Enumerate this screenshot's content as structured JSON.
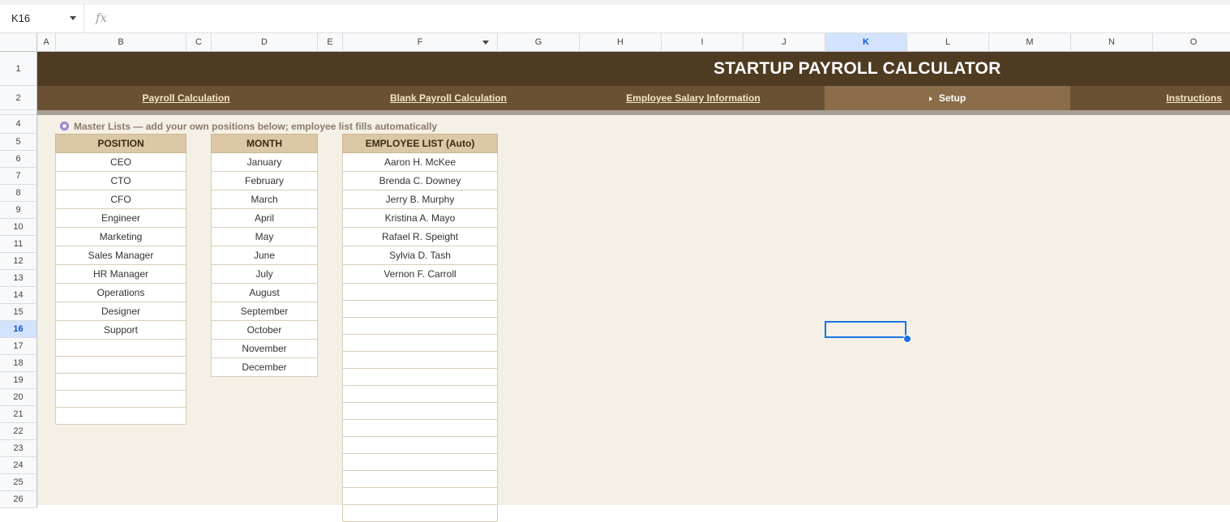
{
  "formula_bar": {
    "name_box": "K16",
    "fx_label": "fx"
  },
  "columns": [
    "A",
    "B",
    "C",
    "D",
    "E",
    "F",
    "G",
    "H",
    "I",
    "J",
    "K",
    "L",
    "M",
    "N",
    "O"
  ],
  "selected_column": "K",
  "rows": [
    "1",
    "2",
    "",
    "4",
    "5",
    "6",
    "7",
    "8",
    "9",
    "10",
    "11",
    "12",
    "13",
    "14",
    "15",
    "16",
    "17",
    "18",
    "19",
    "20",
    "21",
    "22",
    "23",
    "24",
    "25",
    "26"
  ],
  "selected_row": "16",
  "banner": {
    "title": "STARTUP PAYROLL CALCULATOR"
  },
  "nav": {
    "payroll": "Payroll Calculation",
    "blank_payroll": "Blank Payroll Calculation",
    "employee_salary": "Employee Salary Information",
    "setup": "Setup",
    "instructions": "Instructions"
  },
  "note": "Master Lists — add your own positions below; employee list fills automatically",
  "positions": {
    "header": "POSITION",
    "items": [
      "CEO",
      "CTO",
      "CFO",
      "Engineer",
      "Marketing",
      "Sales Manager",
      "HR Manager",
      "Operations",
      "Designer",
      "Support",
      "",
      "",
      "",
      "",
      ""
    ]
  },
  "months": {
    "header": "MONTH",
    "items": [
      "January",
      "February",
      "March",
      "April",
      "May",
      "June",
      "July",
      "August",
      "September",
      "October",
      "November",
      "December"
    ]
  },
  "employees": {
    "header": "EMPLOYEE LIST (Auto)",
    "items": [
      "Aaron H. McKee",
      "Brenda C. Downey",
      "Jerry B. Murphy",
      "Kristina A. Mayo",
      "Rafael R. Speight",
      "Sylvia D. Tash",
      "Vernon F. Carroll",
      "",
      "",
      "",
      "",
      "",
      "",
      "",
      "",
      "",
      "",
      "",
      "",
      "",
      ""
    ]
  },
  "colors": {
    "banner": "#4e3b22",
    "nav": "#6b5133",
    "nav_active": "#8b6d49",
    "sheet_bg": "#f5f0e6",
    "header_fill": "#dcc8a6",
    "selection": "#1a73e8"
  }
}
